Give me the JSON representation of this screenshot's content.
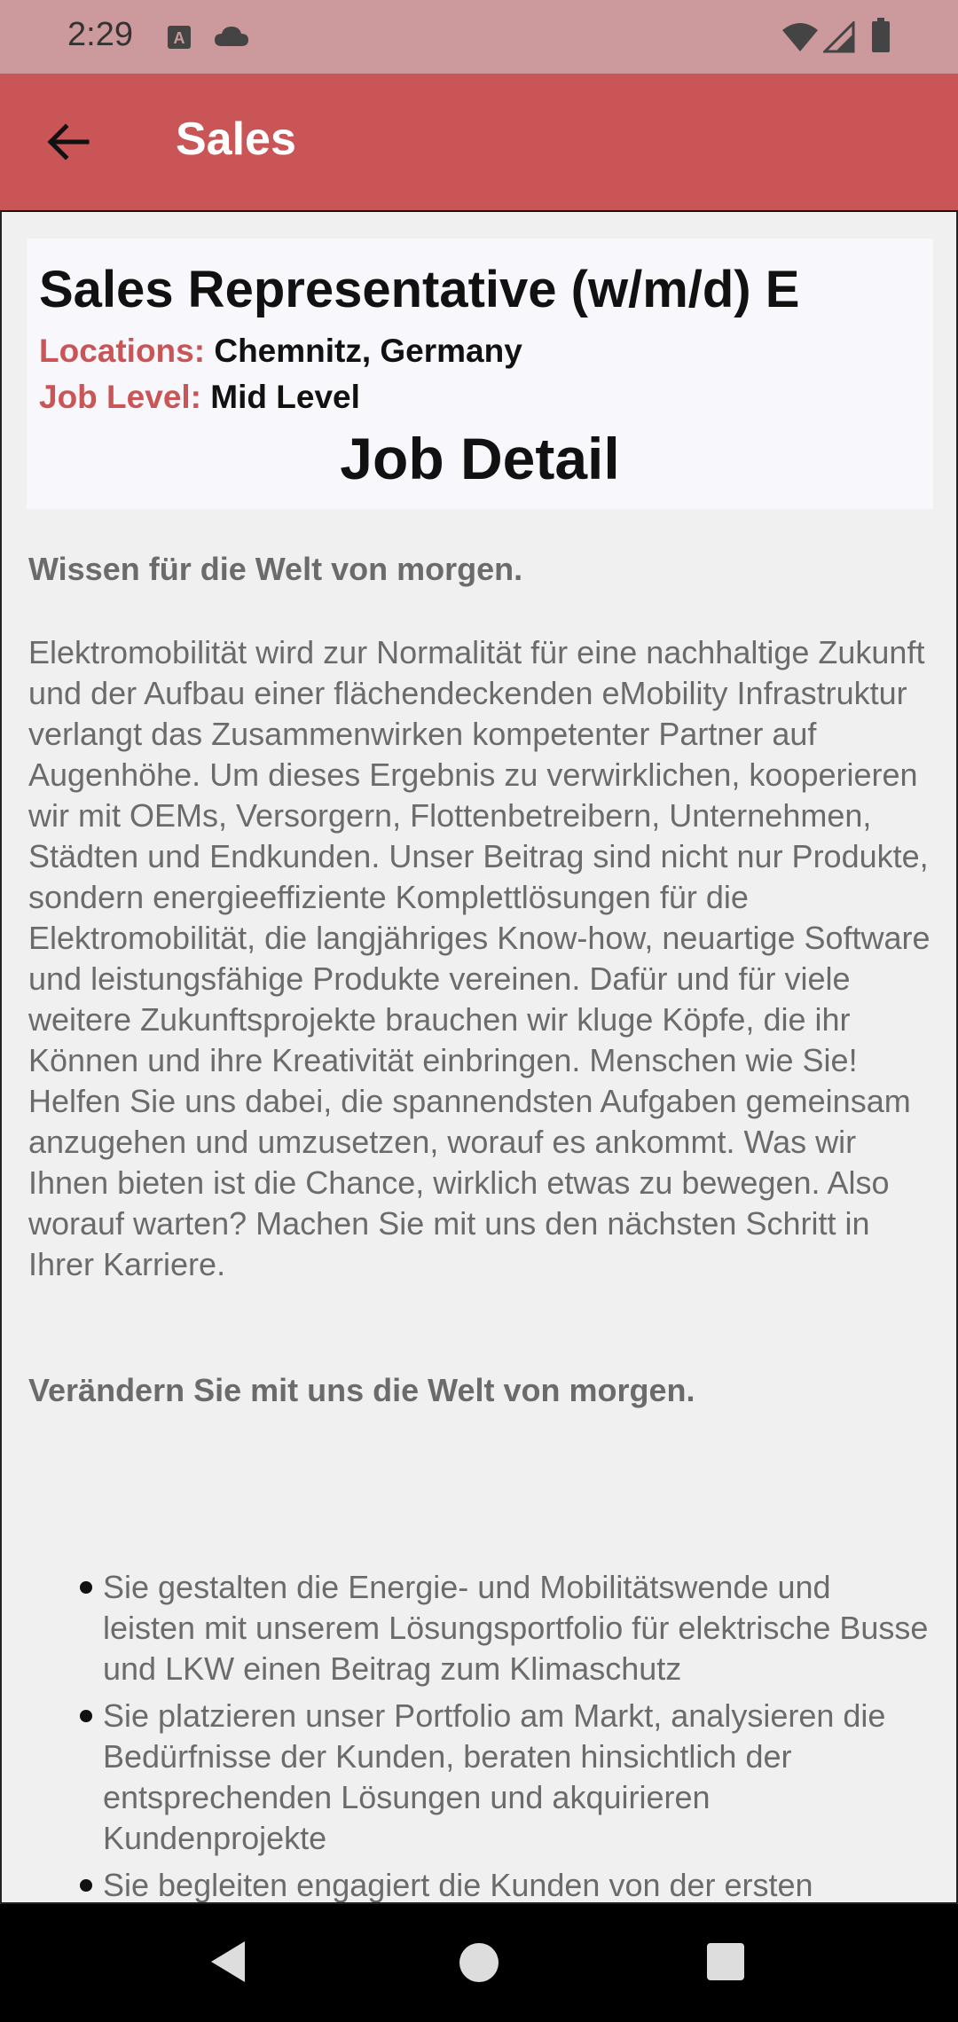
{
  "status_bar": {
    "time": "2:29",
    "icons": [
      "a-notification-icon",
      "cloud-icon",
      "wifi-icon",
      "signal-icon",
      "battery-icon"
    ]
  },
  "app_bar": {
    "title": "Sales",
    "back_icon": "arrow-left-icon",
    "background_color": "#c95556"
  },
  "job": {
    "title": "Sales Representative (w/m/d) E",
    "location_label": "Locations:",
    "location_value": "Chemnitz, Germany",
    "level_label": "Job Level:",
    "level_value": "Mid Level",
    "detail_heading": "Job Detail",
    "label_color": "#c95556"
  },
  "description": {
    "lead": "Wissen für die Welt von morgen.",
    "paragraph": "Elektromobilität wird zur Normalität für eine nachhaltige Zukunft und der Aufbau einer flächendeckenden eMobility Infrastruktur verlangt das Zusammenwirken kompetenter Partner auf Augenhöhe. Um dieses Ergebnis zu verwirklichen, kooperieren wir mit OEMs, Versorgern, Flottenbetreibern, Unternehmen, Städten und Endkunden. Unser Beitrag sind nicht nur Produkte, sondern energieeffiziente Komplettlösungen für die Elektromobilität, die langjähriges Know-how, neuartige Software und leistungsfähige Produkte vereinen. Dafür und für viele weitere Zukunftsprojekte brauchen wir kluge Köpfe, die ihr Können und ihre Kreativität einbringen. Menschen wie Sie! Helfen Sie uns dabei, die spannendsten Aufgaben gemeinsam anzugehen und umzusetzen, worauf es ankommt. Was wir Ihnen bieten ist die Chance, wirklich etwas zu bewegen. Also worauf warten? Machen Sie mit uns den nächsten Schritt in Ihrer Karriere.",
    "closing": "Verändern Sie mit uns die Welt von morgen.",
    "bullets": [
      "Sie gestalten die Energie- und Mobilitätswende und leisten mit unserem Lösungsportfolio für elektrische Busse und LKW einen Beitrag zum Klimaschutz",
      "Sie platzieren unser Portfolio am Markt, analysieren die Bedürfnisse der Kunden, beraten hinsichtlich der entsprechenden Lösungen und akquirieren Kundenprojekte",
      "Sie begleiten engagiert die Kunden von der ersten"
    ]
  },
  "nav_bar": {
    "icons": [
      "nav-back-icon",
      "nav-home-icon",
      "nav-recents-icon"
    ]
  }
}
